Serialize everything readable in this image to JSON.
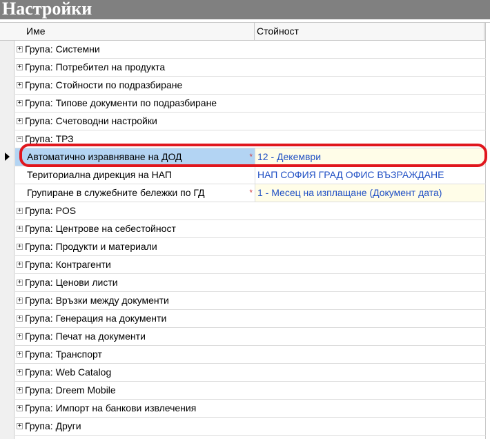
{
  "window": {
    "title": "Настройки"
  },
  "columns": {
    "name": "Име",
    "value": "Стойност"
  },
  "icons": {
    "collapsed": "plus-icon",
    "expanded": "minus-icon",
    "pointer": "row-pointer-icon"
  },
  "colors": {
    "highlight": "#e0161d",
    "value_text": "#1f4fc4",
    "selected": "#b3d4f3"
  },
  "groups_before": [
    {
      "label": "Група: Системни",
      "toggle": "+"
    },
    {
      "label": "Група: Потребител на продукта",
      "toggle": "+"
    },
    {
      "label": "Група: Стойности по подразбиране",
      "toggle": "+"
    },
    {
      "label": "Група: Типове документи по подразбиране",
      "toggle": "+"
    },
    {
      "label": "Група: Счетоводни настройки",
      "toggle": "+"
    }
  ],
  "expanded_group": {
    "label": "Група: ТРЗ",
    "toggle": "−",
    "items": [
      {
        "name": "Автоматично изравняване на ДОД",
        "value": "12 - Декември",
        "required": "*"
      },
      {
        "name": "Териториална дирекция на НАП",
        "value": "НАП СОФИЯ ГРАД ОФИС ВЪЗРАЖДАНЕ",
        "required": ""
      },
      {
        "name": "Групиране в служебните бележки по ГД",
        "value": "1 - Месец на изплащане (Документ дата)",
        "required": "*"
      }
    ]
  },
  "groups_after": [
    {
      "label": "Група: POS",
      "toggle": "+"
    },
    {
      "label": "Група: Центрове на себестойност",
      "toggle": "+"
    },
    {
      "label": "Група: Продукти и материали",
      "toggle": "+"
    },
    {
      "label": "Група: Контрагенти",
      "toggle": "+"
    },
    {
      "label": "Група: Ценови листи",
      "toggle": "+"
    },
    {
      "label": "Група: Връзки между документи",
      "toggle": "+"
    },
    {
      "label": "Група: Генерация на документи",
      "toggle": "+"
    },
    {
      "label": "Група: Печат на документи",
      "toggle": "+"
    },
    {
      "label": "Група: Транспорт",
      "toggle": "+"
    },
    {
      "label": "Група: Web Catalog",
      "toggle": "+"
    },
    {
      "label": "Група: Dreem Mobile",
      "toggle": "+"
    },
    {
      "label": "Група: Импорт на банкови извлечения",
      "toggle": "+"
    },
    {
      "label": "Група: Други",
      "toggle": "+"
    }
  ]
}
